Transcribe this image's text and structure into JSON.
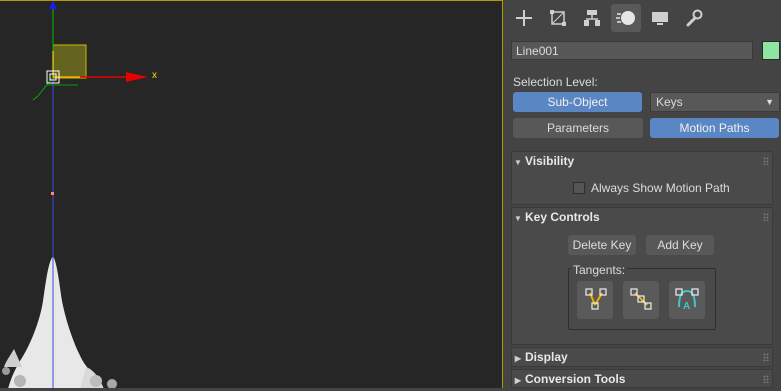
{
  "viewport": {
    "axis_x_label": "x",
    "accent": "#b59a00"
  },
  "tabs": [
    {
      "icon": "create-icon"
    },
    {
      "icon": "modify-icon"
    },
    {
      "icon": "hierarchy-icon"
    },
    {
      "icon": "motion-icon",
      "active": true
    },
    {
      "icon": "display-icon"
    },
    {
      "icon": "utilities-icon"
    }
  ],
  "object": {
    "name": "Line001",
    "color": "#8fe6a3"
  },
  "selection": {
    "label": "Selection Level:",
    "sub_object_label": "Sub-Object",
    "level_value": "Keys"
  },
  "mode_buttons": {
    "parameters_label": "Parameters",
    "motion_paths_label": "Motion Paths"
  },
  "rollouts": {
    "visibility": {
      "title": "Visibility",
      "checkbox_label": "Always Show Motion Path"
    },
    "key_controls": {
      "title": "Key Controls",
      "delete_key_label": "Delete Key",
      "add_key_label": "Add Key",
      "tangents_label": "Tangents:"
    },
    "display": {
      "title": "Display"
    },
    "conversion_tools": {
      "title": "Conversion Tools"
    }
  },
  "colors": {
    "accent_blue": "#5b86c4",
    "panel_bg": "#444444"
  }
}
